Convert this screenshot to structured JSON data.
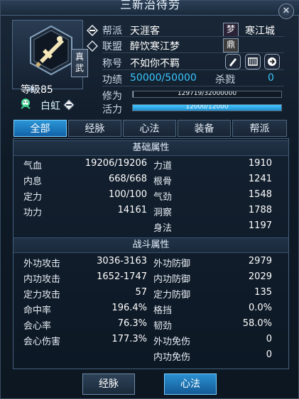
{
  "window": {
    "title": "三新治待劳"
  },
  "profile": {
    "school_label": "真武",
    "level_label": "等级85",
    "mark_name": "白虹"
  },
  "fields": {
    "faction_label": "帮派",
    "faction_value": "天涯客",
    "dream_tag": "梦",
    "faction_city": "寒江城",
    "alliance_label": "联盟",
    "alliance_value": "醉饮寒江梦",
    "alliance_tag": "鼎",
    "title_label": "称号",
    "title_value": "不如你不羁",
    "merit_label": "功绩",
    "merit_value": "50000/50000",
    "kill_label": "杀戮",
    "kill_value": "0",
    "cultivation_label": "修为",
    "cultivation_value": "129719/32000000",
    "vitality_label": "活力",
    "vitality_value": "12000/12000"
  },
  "bars": {
    "cultivation_fraction": 0.004,
    "vitality_fraction": 1.0,
    "cultivation_color": "#b8c5d3",
    "vitality_color": "#46c8ff"
  },
  "tabs": [
    {
      "label": "全部"
    },
    {
      "label": "经脉"
    },
    {
      "label": "心法"
    },
    {
      "label": "装备"
    },
    {
      "label": "帮派"
    }
  ],
  "sections": {
    "basic_title": "基础属性",
    "battle_title": "战斗属性"
  },
  "basic_rows": [
    {
      "k": "气血",
      "v": "19206/19206",
      "k2": "力道",
      "v2": "1910"
    },
    {
      "k": "内息",
      "v": "668/668",
      "k2": "根骨",
      "v2": "1241"
    },
    {
      "k": "定力",
      "v": "100/100",
      "k2": "气劲",
      "v2": "1548"
    },
    {
      "k": "功力",
      "v": "14161",
      "k2": "洞察",
      "v2": "1788"
    },
    {
      "k": "",
      "v": "",
      "k2": "身法",
      "v2": "1197"
    }
  ],
  "battle_rows": [
    {
      "k": "外功攻击",
      "v": "3036-3163",
      "k2": "外功防御",
      "v2": "2979"
    },
    {
      "k": "内功攻击",
      "v": "1652-1747",
      "k2": "内功防御",
      "v2": "2029"
    },
    {
      "k": "定力攻击",
      "v": "57",
      "k2": "定力防御",
      "v2": "135"
    },
    {
      "k": "命中率",
      "v": "196.4%",
      "k2": "格挡",
      "v2": "0.0%"
    },
    {
      "k": "会心率",
      "v": "76.3%",
      "k2": "韧劲",
      "v2": "58.0%"
    },
    {
      "k": "会心伤害",
      "v": "177.3%",
      "k2": "外功免伤",
      "v2": "0"
    },
    {
      "k": "",
      "v": "",
      "k2": "内功免伤",
      "v2": "0"
    }
  ],
  "buttons": {
    "meridian_label": "经脉",
    "mind_label": "心法"
  },
  "icons": {
    "close": "close-icon",
    "avatar": "sword-hexagon-icon",
    "snow": "snowflake-icon",
    "mark": "mark-icon",
    "mark2": "diamond-arrow-icon",
    "faction": "faction-icon",
    "alliance": "alliance-icon",
    "title_edit": "pencil-icon",
    "title_list": "list-icon",
    "title_share": "share-icon"
  },
  "colors": {
    "accent": "#39c6ff",
    "tab_active": "#1f7cc0",
    "text": "#e8eef5"
  }
}
